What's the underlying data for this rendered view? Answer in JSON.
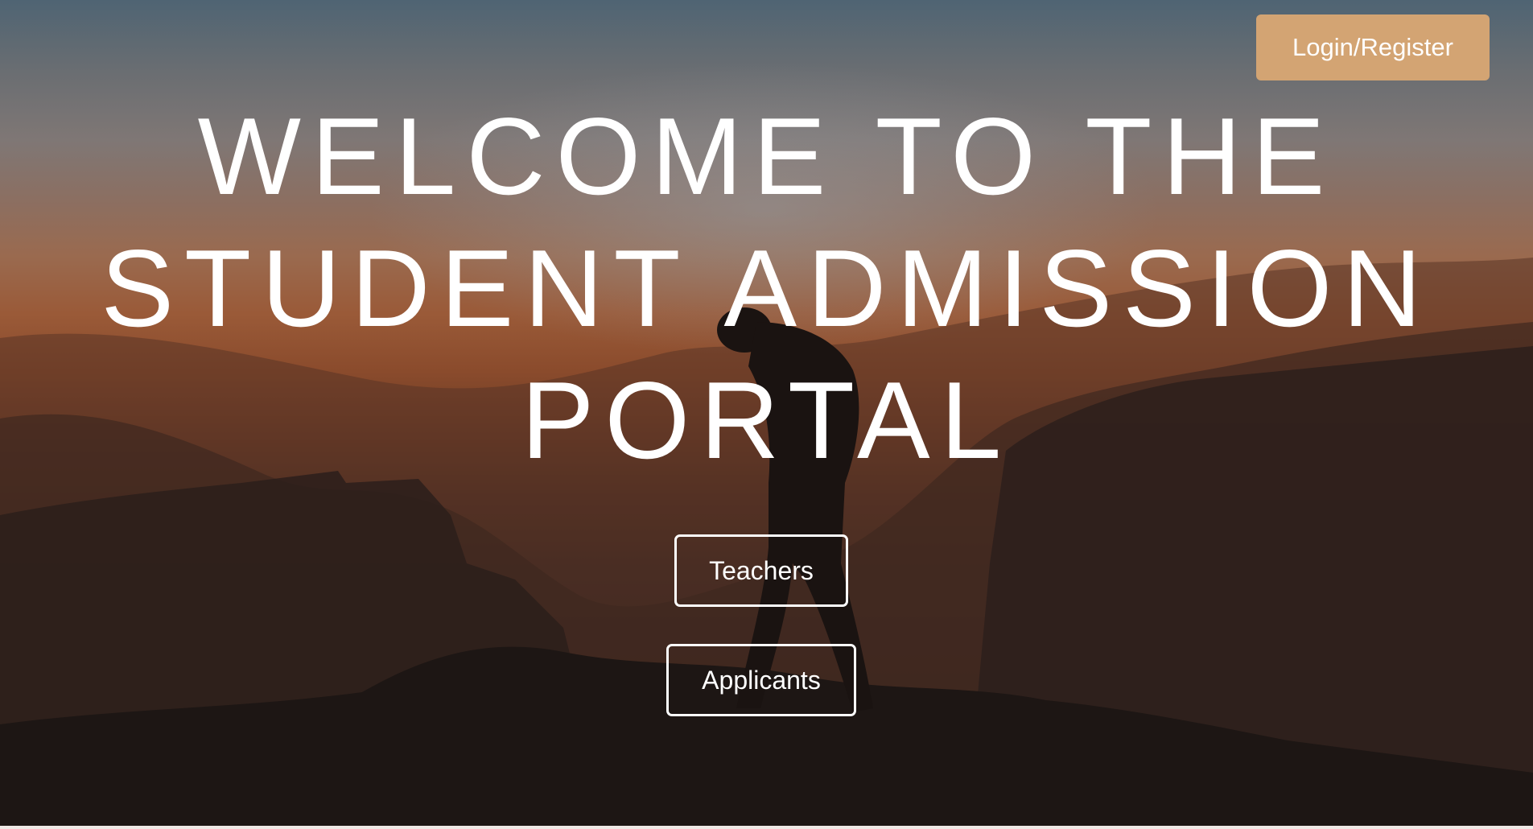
{
  "header": {
    "login_label": "Login/Register"
  },
  "hero": {
    "title_lines": [
      "WELCOME TO THE",
      "STUDENT ADMISSION",
      "PORTAL"
    ],
    "teachers_label": "Teachers",
    "applicants_label": "Applicants"
  },
  "colors": {
    "login_button_bg": "#d3a473",
    "text": "#ffffff"
  }
}
